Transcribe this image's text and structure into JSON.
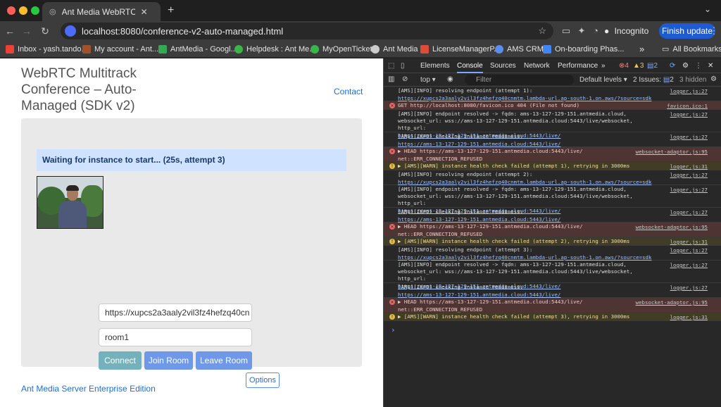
{
  "browser": {
    "tab_title": "Ant Media WebRTC Confe",
    "new_tab": "+",
    "url": "localhost:8080/conference-v2-auto-managed.html",
    "incognito_label": "Incognito",
    "update_label": "Finish update"
  },
  "bookmarks": [
    {
      "label": "Inbox - yash.tando...",
      "color": "#ea4335"
    },
    {
      "label": "My account - Ant...",
      "color": "#a0522d"
    },
    {
      "label": "AntMedia - Googl...",
      "color": "#34a853"
    },
    {
      "label": "Helpdesk : Ant Me...",
      "color": "#3ab54a"
    },
    {
      "label": "MyOpenTickets",
      "color": "#3ab54a"
    },
    {
      "label": "Ant Media",
      "color": "#cccccc"
    },
    {
      "label": "LicenseManagerP...",
      "color": "#dd4b39"
    },
    {
      "label": "AMS CRM",
      "color": "#5b8def"
    },
    {
      "label": "On-boarding Phas...",
      "color": "#4285f4"
    }
  ],
  "all_bookmarks": "All Bookmarks",
  "page": {
    "title": "WebRTC Multitrack Conference – Auto-Managed (SDK v2)",
    "contact": "Contact",
    "status": "Waiting for instance to start... (25s, attempt 3)",
    "endpoint_value": "https://xupcs2a3aaly2vil3fz4hefzq40cn",
    "room_value": "room1",
    "connect_label": "Connect",
    "join_label": "Join Room",
    "leave_label": "Leave Room",
    "options_label": "Options",
    "footer": "Ant Media Server Enterprise Edition"
  },
  "devtools": {
    "tabs": [
      "Elements",
      "Console",
      "Sources",
      "Network",
      "Performance"
    ],
    "more": "»",
    "error_count": "4",
    "warn_count": "3",
    "issue_count": "2",
    "context": "top",
    "filter_placeholder": "Filter",
    "levels": "Default levels",
    "issues": "2 Issues:",
    "issues_count": "2",
    "hidden": "3 hidden",
    "prompt": "›",
    "rows": [
      {
        "type": "info",
        "msg": "[AMS][INFO] resolving endpoint (attempt 1):",
        "link": "https://xupcs2a3aaly2vil3fz4hefzq40cnmtm.lambda-url.ap-south-1.on.aws/?source=sdk",
        "src": "logger.js:27"
      },
      {
        "type": "err",
        "msg": "GET http://localhost:8080/favicon.ico 404 (File not found)",
        "link": "",
        "src": "favicon.ico:1"
      },
      {
        "type": "info",
        "msg": "[AMS][INFO] endpoint resolved -> fqdn: ams-13-127-129-151.antmedia.cloud, websocket_url: wss://ams-13-127-129-151.antmedia.cloud:5443/live/websocket, http_url:",
        "link": "https://ams-13-127-129-151.antmedia.cloud:5443/live/",
        "src": "logger.js:27"
      },
      {
        "type": "info",
        "msg": "[AMS][INFO] checking instance readiness:",
        "link": "https://ams-13-127-129-151.antmedia.cloud:5443/live/",
        "src": "logger.js:27"
      },
      {
        "type": "err",
        "msg": "▶ HEAD https://ams-13-127-129-151.antmedia.cloud:5443/live/",
        "link": "net::ERR_CONNECTION_REFUSED",
        "src": "websocket-adaptor.js:95"
      },
      {
        "type": "warn",
        "msg": "▶ [AMS][WARN] instance health check failed (attempt 1), retrying in 3000ms",
        "link": "",
        "src": "logger.js:31"
      },
      {
        "type": "info",
        "msg": "[AMS][INFO] resolving endpoint (attempt 2):",
        "link": "https://xupcs2a3aaly2vil3fz4hefzq40cnmtm.lambda-url.ap-south-1.on.aws/?source=sdk",
        "src": "logger.js:27"
      },
      {
        "type": "info",
        "msg": "[AMS][INFO] endpoint resolved -> fqdn: ams-13-127-129-151.antmedia.cloud, websocket_url: wss://ams-13-127-129-151.antmedia.cloud:5443/live/websocket, http_url:",
        "link": "https://ams-13-127-129-151.antmedia.cloud:5443/live/",
        "src": "logger.js:27"
      },
      {
        "type": "info",
        "msg": "[AMS][INFO] checking instance readiness:",
        "link": "https://ams-13-127-129-151.antmedia.cloud:5443/live/",
        "src": "logger.js:27"
      },
      {
        "type": "err",
        "msg": "▶ HEAD https://ams-13-127-129-151.antmedia.cloud:5443/live/",
        "link": "net::ERR_CONNECTION_REFUSED",
        "src": "websocket-adaptor.js:95"
      },
      {
        "type": "warn",
        "msg": "▶ [AMS][WARN] instance health check failed (attempt 2), retrying in 3000ms",
        "link": "",
        "src": "logger.js:31"
      },
      {
        "type": "info",
        "msg": "[AMS][INFO] resolving endpoint (attempt 3):",
        "link": "https://xupcs2a3aaly2vil3fz4hefzq40cnmtm.lambda-url.ap-south-1.on.aws/?source=sdk",
        "src": "logger.js:27"
      },
      {
        "type": "info",
        "msg": "[AMS][INFO] endpoint resolved -> fqdn: ams-13-127-129-151.antmedia.cloud, websocket_url: wss://ams-13-127-129-151.antmedia.cloud:5443/live/websocket, http_url:",
        "link": "https://ams-13-127-129-151.antmedia.cloud:5443/live/",
        "src": "logger.js:27"
      },
      {
        "type": "info",
        "msg": "[AMS][INFO] checking instance readiness:",
        "link": "https://ams-13-127-129-151.antmedia.cloud:5443/live/",
        "src": "logger.js:27"
      },
      {
        "type": "err",
        "msg": "▶ HEAD https://ams-13-127-129-151.antmedia.cloud:5443/live/",
        "link": "net::ERR_CONNECTION_REFUSED",
        "src": "websocket-adaptor.js:95"
      },
      {
        "type": "warn",
        "msg": "▶ [AMS][WARN] instance health check failed (attempt 3), retrying in 3000ms",
        "link": "",
        "src": "logger.js:31"
      }
    ]
  }
}
